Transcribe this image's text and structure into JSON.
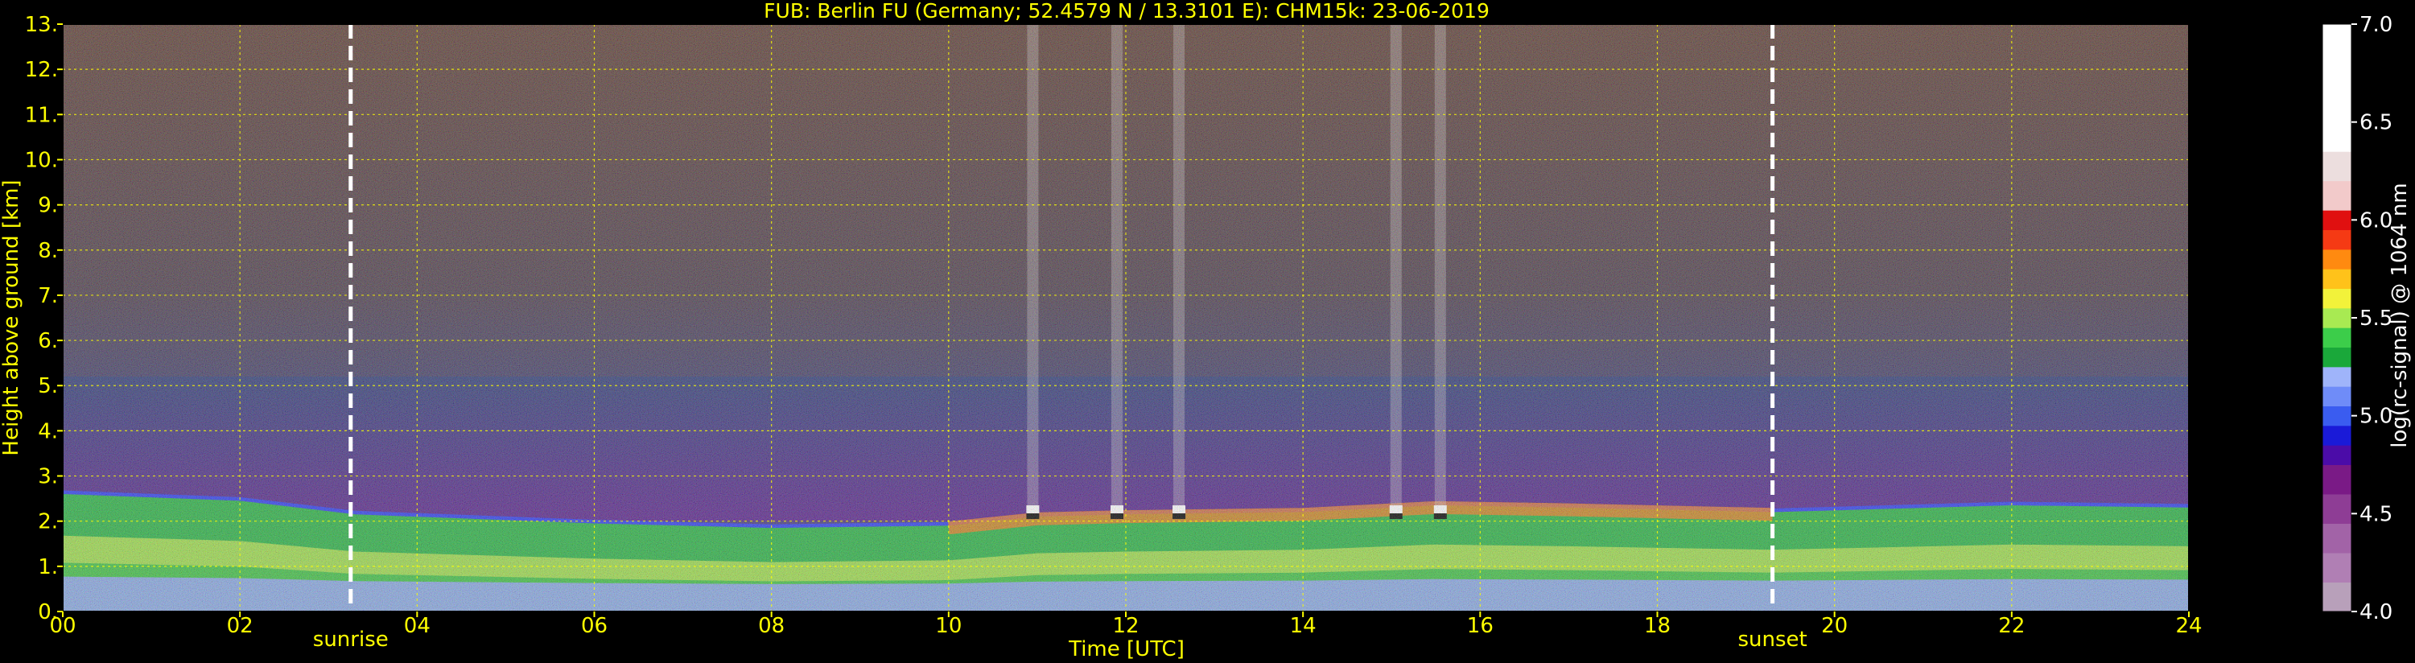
{
  "chart_data": {
    "type": "heatmap",
    "title": "FUB: Berlin FU (Germany; 52.4579 N / 13.3101 E):    CHM15k: 23-06-2019",
    "xlabel": "Time [UTC]",
    "ylabel": "Height above ground [km]",
    "xlim": [
      0,
      24
    ],
    "ylim": [
      0,
      13
    ],
    "x_ticks": [
      {
        "value": 0,
        "label": "00"
      },
      {
        "value": 2,
        "label": "02"
      },
      {
        "value": 4,
        "label": "04"
      },
      {
        "value": 6,
        "label": "06"
      },
      {
        "value": 8,
        "label": "08"
      },
      {
        "value": 10,
        "label": "10"
      },
      {
        "value": 12,
        "label": "12"
      },
      {
        "value": 14,
        "label": "14"
      },
      {
        "value": 16,
        "label": "16"
      },
      {
        "value": 18,
        "label": "18"
      },
      {
        "value": 20,
        "label": "20"
      },
      {
        "value": 22,
        "label": "22"
      },
      {
        "value": 24,
        "label": "24"
      }
    ],
    "y_ticks": [
      {
        "value": 0,
        "label": "0."
      },
      {
        "value": 1,
        "label": "1."
      },
      {
        "value": 2,
        "label": "2."
      },
      {
        "value": 3,
        "label": "3."
      },
      {
        "value": 4,
        "label": "4."
      },
      {
        "value": 5,
        "label": "5."
      },
      {
        "value": 6,
        "label": "6."
      },
      {
        "value": 7,
        "label": "7."
      },
      {
        "value": 8,
        "label": "8."
      },
      {
        "value": 9,
        "label": "9."
      },
      {
        "value": 10,
        "label": "10."
      },
      {
        "value": 11,
        "label": "11."
      },
      {
        "value": 12,
        "label": "12."
      },
      {
        "value": 13,
        "label": "13."
      }
    ],
    "grid": true,
    "annotations": [
      {
        "label": "sunrise",
        "time": 3.25
      },
      {
        "label": "sunset",
        "time": 19.3
      }
    ],
    "boundary_layer_top_km": [
      {
        "t": 0,
        "h": 2.6
      },
      {
        "t": 2,
        "h": 2.45
      },
      {
        "t": 3.3,
        "h": 2.15
      },
      {
        "t": 6,
        "h": 1.95
      },
      {
        "t": 8,
        "h": 1.85
      },
      {
        "t": 10,
        "h": 1.9
      },
      {
        "t": 11,
        "h": 2.1
      },
      {
        "t": 12,
        "h": 2.15
      },
      {
        "t": 14,
        "h": 2.2
      },
      {
        "t": 15.5,
        "h": 2.35
      },
      {
        "t": 17,
        "h": 2.3
      },
      {
        "t": 19.3,
        "h": 2.2
      },
      {
        "t": 22,
        "h": 2.35
      },
      {
        "t": 24,
        "h": 2.3
      }
    ],
    "cloud_columns_utc": [
      10.95,
      11.9,
      12.6,
      15.05,
      15.55
    ],
    "colorbar": {
      "label": "log(rc-signal) @ 1064 nm",
      "range": [
        4.0,
        7.0
      ],
      "ticks": [
        {
          "value": 4.0,
          "label": "4.0"
        },
        {
          "value": 4.5,
          "label": "4.5"
        },
        {
          "value": 5.0,
          "label": "5.0"
        },
        {
          "value": 5.5,
          "label": "5.5"
        },
        {
          "value": 6.0,
          "label": "6.0"
        },
        {
          "value": 6.5,
          "label": "6.5"
        },
        {
          "value": 7.0,
          "label": "7.0"
        }
      ],
      "stops": [
        {
          "from": 4.0,
          "to": 4.15,
          "color": "#b8a0ba"
        },
        {
          "from": 4.15,
          "to": 4.3,
          "color": "#b07fb4"
        },
        {
          "from": 4.3,
          "to": 4.45,
          "color": "#a263a7"
        },
        {
          "from": 4.45,
          "to": 4.6,
          "color": "#8e3d95"
        },
        {
          "from": 4.6,
          "to": 4.75,
          "color": "#7a1a86"
        },
        {
          "from": 4.75,
          "to": 4.85,
          "color": "#4b0ca8"
        },
        {
          "from": 4.85,
          "to": 4.95,
          "color": "#1a1ad8"
        },
        {
          "from": 4.95,
          "to": 5.05,
          "color": "#3a5cf0"
        },
        {
          "from": 5.05,
          "to": 5.15,
          "color": "#6f8cf8"
        },
        {
          "from": 5.15,
          "to": 5.25,
          "color": "#9fb4fa"
        },
        {
          "from": 5.25,
          "to": 5.35,
          "color": "#1aa83a"
        },
        {
          "from": 5.35,
          "to": 5.45,
          "color": "#3ccd4a"
        },
        {
          "from": 5.45,
          "to": 5.55,
          "color": "#a8ea52"
        },
        {
          "from": 5.55,
          "to": 5.65,
          "color": "#f2f23a"
        },
        {
          "from": 5.65,
          "to": 5.75,
          "color": "#ffc21a"
        },
        {
          "from": 5.75,
          "to": 5.85,
          "color": "#ff8a10"
        },
        {
          "from": 5.85,
          "to": 5.95,
          "color": "#f53a14"
        },
        {
          "from": 5.95,
          "to": 6.05,
          "color": "#e01010"
        },
        {
          "from": 6.05,
          "to": 6.2,
          "color": "#f2caca"
        },
        {
          "from": 6.2,
          "to": 6.35,
          "color": "#ecdede"
        },
        {
          "from": 6.35,
          "to": 7.0,
          "color": "#ffffff"
        }
      ]
    }
  },
  "colors": {
    "background": "#000000",
    "text": "#ffff00",
    "grid": "#ffff00",
    "sun_lines": "#ffffff"
  }
}
